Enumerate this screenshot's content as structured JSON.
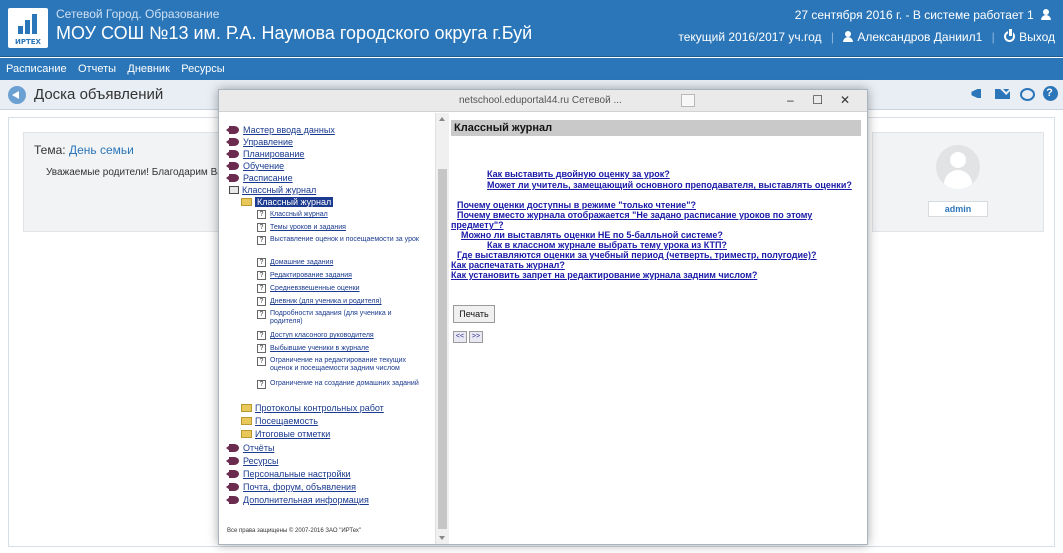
{
  "header": {
    "logo_text": "ИРТЕХ",
    "app_name": "Сетевой Город. Образование",
    "school_name": "МОУ СОШ №13 им. Р.А. Наумова городского округа г.Буй",
    "date_status": "27 сентября 2016 г. - В системе работает 1",
    "school_year": "текущий 2016/2017 уч.год",
    "user_name": "Александров Даниил1",
    "logout_label": "Выход"
  },
  "navbar": {
    "items": [
      "Расписание",
      "Отчеты",
      "Дневник",
      "Ресурсы"
    ]
  },
  "titlebar": {
    "page_title": "Доска объявлений"
  },
  "announcement": {
    "topic_prefix": "Тема:",
    "topic": "День семьи",
    "text": "Уважаемые родители! Благодарим Вас",
    "author": "admin"
  },
  "popup": {
    "title": "netschool.eduportal44.ru  Сетевой ...",
    "controls": {
      "minimize": "–",
      "maximize": "☐",
      "close": "✕"
    },
    "tree": [
      "Мастер ввода данных",
      "Управление",
      "Планирование",
      "Обучение",
      "Расписание",
      "Классный журнал",
      "Классный журнал",
      "Классный журнал",
      "Темы уроков и задания",
      "Выставление оценок и посещаемости за урок",
      "Домашние задания",
      "Редактирование задания",
      "Средневзвешенные оценки",
      "Дневник (для ученика и родителя)",
      "Подробности задания (для ученика и родителя)",
      "Доступ класоного руководителя",
      "Выбывшие ученики в журнале",
      "Ограничение на редактирование текущих оценок и посещаемости задним числом",
      "Ограничение на создание домашних заданий",
      "Протоколы контрольных работ",
      "Посещаемость",
      "Итоговые отметки",
      "Отчёты",
      "Ресурсы",
      "Персональные настройки",
      "Почта, форум, объявления",
      "Дополнительная информация"
    ],
    "copyright": "Все права защищены © 2007-2016 ЗАО \"ИРТех\"",
    "content_heading": "Классный журнал",
    "faq": [
      "Как выставить двойную оценку за урок?",
      "Может ли учитель, замещающий основного преподавателя, выставлять оценки?",
      "Почему оценки доступны в режиме \"только чтение\"?",
      "Почему вместо журнала отображается \"Не задано расписание уроков по этому",
      "предмету\"?",
      "Можно ли выставлять оценки НЕ по 5-балльной системе?",
      "Как в классном журнале выбрать тему урока из КТП?",
      "Где выставляются оценки за учебный период (четверть, триместр, полугодие)?",
      "Как распечатать журнал?",
      "Как установить запрет на редактирование журнала задним числом?"
    ],
    "print_label": "Печать",
    "prev_label": "<<",
    "next_label": ">>"
  },
  "colors": {
    "brand_blue": "#2b76b9",
    "link_blue": "#1a1aa8",
    "active_tree": "#1c3a8f",
    "bullet": "#6b2b4f"
  },
  "icons": [
    "user-icon",
    "power-icon",
    "back-arrow-icon",
    "megaphone-icon",
    "mail-icon",
    "chat-icon",
    "help-icon",
    "folder-icon",
    "help-topic-icon"
  ]
}
